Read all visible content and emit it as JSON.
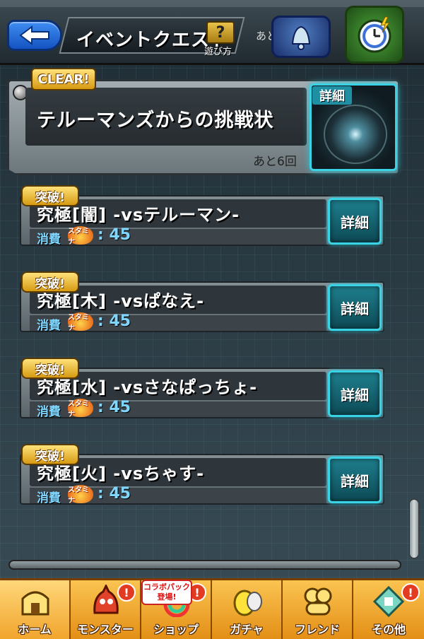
{
  "header": {
    "title": "イベントクエスト",
    "help_label": "遊び方",
    "help_icon": "?",
    "remain_prefix": "あと"
  },
  "event": {
    "clear_badge": "CLEAR!",
    "title": "テルーマンズからの挑戦状",
    "remaining": "あと6回",
    "detail_label": "詳細"
  },
  "quests": [
    {
      "badge": "突破!",
      "name": "究極[闇] -vsテルーマン-",
      "stamina_label": "消費",
      "stamina_icon_text": "スタミナ",
      "stamina_value": ": 45",
      "detail_label": "詳細"
    },
    {
      "badge": "突破!",
      "name": "究極[木] -vsぱなえ-",
      "stamina_label": "消費",
      "stamina_icon_text": "スタミナ",
      "stamina_value": ": 45",
      "detail_label": "詳細"
    },
    {
      "badge": "突破!",
      "name": "究極[水] -vsさなぱっちょ-",
      "stamina_label": "消費",
      "stamina_icon_text": "スタミナ",
      "stamina_value": ": 45",
      "detail_label": "詳細"
    },
    {
      "badge": "突破!",
      "name": "究極[火] -vsちゃす-",
      "stamina_label": "消費",
      "stamina_icon_text": "スタミナ",
      "stamina_value": ": 45",
      "detail_label": "詳細"
    }
  ],
  "nav": {
    "items": [
      {
        "label": "ホーム",
        "icon": "home-icon"
      },
      {
        "label": "モンスター",
        "icon": "monster-icon"
      },
      {
        "label": "ショップ",
        "icon": "shop-icon"
      },
      {
        "label": "ガチャ",
        "icon": "gacha-icon"
      },
      {
        "label": "フレンド",
        "icon": "friend-icon"
      },
      {
        "label": "その他",
        "icon": "other-icon"
      }
    ],
    "collab_badge": "コラボパック登場!",
    "alert_mark": "!"
  },
  "colors": {
    "accent_cyan": "#3ad3e6",
    "badge_gold": "#d69a12",
    "nav_orange": "#f0a32a",
    "stamina_text": "#7fd6ff"
  }
}
